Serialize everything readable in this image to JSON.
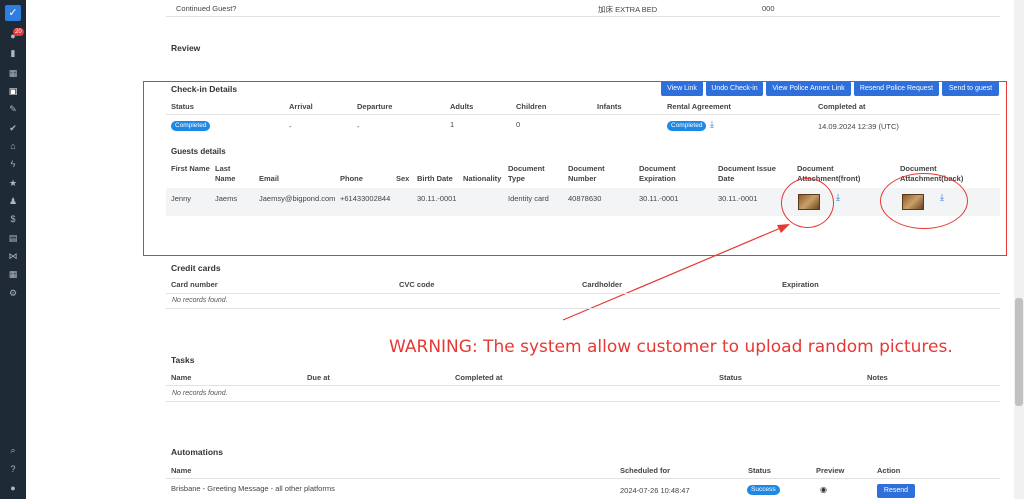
{
  "sidebar": {
    "badge": "20",
    "icons": [
      "check-logo-icon",
      "chat-icon",
      "bar-chart-icon",
      "calendar-icon",
      "calendar-check-icon",
      "brush-icon",
      "checkmark-icon",
      "home-icon",
      "flash-icon",
      "star-icon",
      "users-icon",
      "dollar-icon",
      "briefcase-icon",
      "share-icon",
      "grid-icon",
      "settings-icon",
      "search-icon",
      "help-icon",
      "user-icon"
    ]
  },
  "top_row": {
    "continued_guest_label": "Continued Guest?",
    "extra_bed_label": "加床 EXTRA BED",
    "extra_bed_value": "000"
  },
  "review": {
    "title": "Review"
  },
  "checkin": {
    "title": "Check-in Details",
    "buttons": [
      "View Link",
      "Undo Check-in",
      "View Police Annex Link",
      "Resend Police Request",
      "Send to guest"
    ],
    "columns": [
      "Status",
      "Arrival",
      "Departure",
      "Adults",
      "Children",
      "Infants",
      "Rental Agreement",
      "Completed at"
    ],
    "row": {
      "status": "Completed",
      "arrival": "-",
      "departure": "-",
      "adults": "1",
      "children": "0",
      "infants": "",
      "rental_agreement": "Completed",
      "completed_at": "14.09.2024 12:39 (UTC)"
    }
  },
  "guests": {
    "title": "Guests details",
    "columns": {
      "first_name": "First Name",
      "last_name": "Last Name",
      "email": "Email",
      "phone": "Phone",
      "sex": "Sex",
      "birth_date": "Birth Date",
      "nationality": "Nationality",
      "doc_type": "Document Type",
      "doc_number": "Document Number",
      "doc_expiration": "Document Expiration",
      "doc_issue_date": "Document Issue Date",
      "attach_front": "Document Attachment(front)",
      "attach_back": "Document Attachment(back)"
    },
    "row": {
      "first_name": "Jenny",
      "last_name": "Jaems",
      "email": "Jaemsy@bigpond.com",
      "phone": "+61433002844",
      "sex": "",
      "birth_date": "30.11.-0001",
      "nationality": "",
      "doc_type": "Identity card",
      "doc_number": "40878630",
      "doc_expiration": "30.11.-0001",
      "doc_issue_date": "30.11.-0001"
    }
  },
  "credit_cards": {
    "title": "Credit cards",
    "columns": [
      "Card number",
      "CVC code",
      "Cardholder",
      "Expiration"
    ],
    "empty": "No records found."
  },
  "tasks": {
    "title": "Tasks",
    "columns": [
      "Name",
      "Due at",
      "Completed at",
      "Status",
      "Notes"
    ],
    "empty": "No records found."
  },
  "automations": {
    "title": "Automations",
    "columns": [
      "Name",
      "Scheduled for",
      "Status",
      "Preview",
      "Action"
    ],
    "row": {
      "name": "Brisbane - Greeting Message - all other platforms",
      "scheduled_for": "2024-07-26 10:48:47",
      "status": "Success",
      "action": "Resend"
    }
  },
  "annotation": {
    "warning": "WARNING: The system allow customer to upload random pictures.",
    "color": "#e53935"
  }
}
